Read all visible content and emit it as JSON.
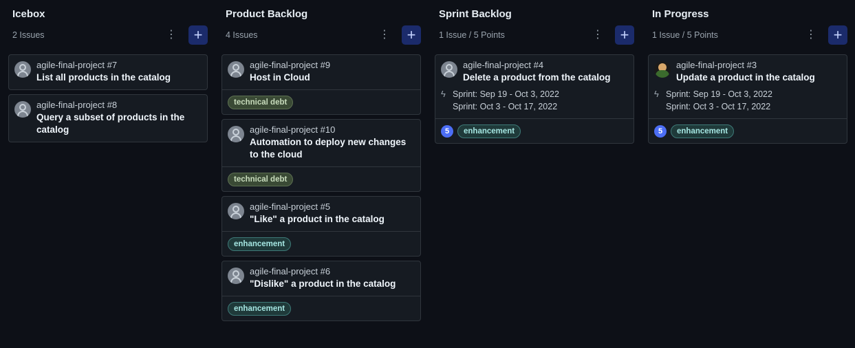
{
  "columns": [
    {
      "title": "Icebox",
      "meta": "2 Issues",
      "menu_icon": "⋮",
      "add_icon": "+",
      "cards": [
        {
          "repo": "agile-final-project #7",
          "title": "List all products in the catalog"
        },
        {
          "repo": "agile-final-project #8",
          "title": "Query a subset of products in the catalog"
        }
      ]
    },
    {
      "title": "Product Backlog",
      "meta": "4 Issues",
      "menu_icon": "⋮",
      "add_icon": "+",
      "cards": [
        {
          "repo": "agile-final-project #9",
          "title": "Host in Cloud",
          "label": "technical debt"
        },
        {
          "repo": "agile-final-project #10",
          "title": "Automation to deploy new changes to the cloud",
          "label": "technical debt"
        },
        {
          "repo": "agile-final-project #5",
          "title": "\"Like\" a product in the catalog",
          "label": "enhancement"
        },
        {
          "repo": "agile-final-project #6",
          "title": "\"Dislike\" a product in the catalog",
          "label": "enhancement"
        }
      ]
    },
    {
      "title": "Sprint Backlog",
      "meta": "1 Issue / 5 Points",
      "menu_icon": "⋮",
      "add_icon": "+",
      "cards": [
        {
          "repo": "agile-final-project #4",
          "title": "Delete a product from the catalog",
          "sprint1": "Sprint: Sep 19 - Oct 3, 2022",
          "sprint2": "Sprint: Oct 3 - Oct 17, 2022",
          "points": "5",
          "label": "enhancement"
        }
      ]
    },
    {
      "title": "In Progress",
      "meta": "1 Issue / 5 Points",
      "menu_icon": "⋮",
      "add_icon": "+",
      "cards": [
        {
          "repo": "agile-final-project #3",
          "title": "Update a product in the catalog",
          "sprint1": "Sprint: Sep 19 - Oct 3, 2022",
          "sprint2": "Sprint: Oct 3 - Oct 17, 2022",
          "points": "5",
          "label": "enhancement"
        }
      ]
    }
  ],
  "icons": {
    "bolt": "ϟ"
  },
  "colors": {
    "background": "#0d1017",
    "card": "#161b22",
    "add_button": "#1b2b6b",
    "points_badge": "#4c6ef5"
  }
}
